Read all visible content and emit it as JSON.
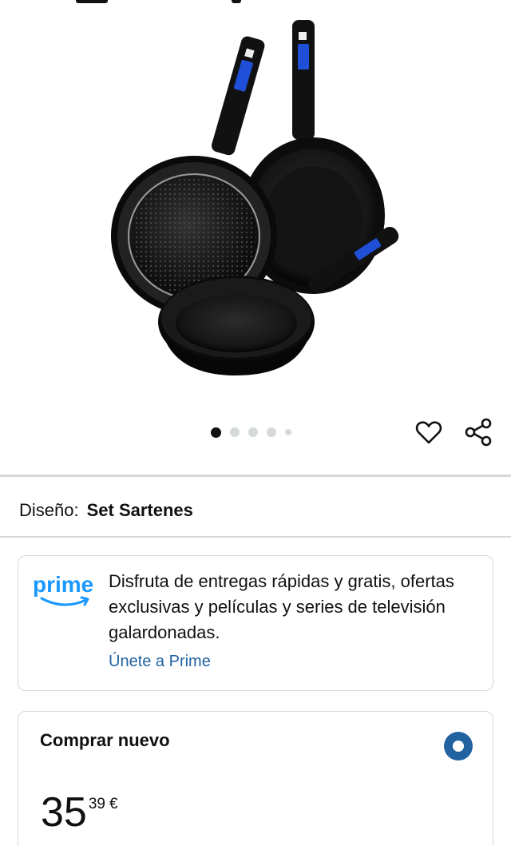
{
  "product": {
    "image_icon": "frying-pan-set-image",
    "carousel": {
      "total": 5,
      "active_index": 0
    }
  },
  "actions": {
    "wishlist_icon": "heart-icon",
    "share_icon": "share-icon"
  },
  "design": {
    "label": "Diseño:",
    "value": "Set Sartenes"
  },
  "prime": {
    "logo_text": "prime",
    "text": "Disfruta de entregas rápidas y gratis, ofertas exclusivas y películas y series de televisión galardonadas.",
    "link": "Únete a Prime",
    "brand_color": "#1a98ff"
  },
  "buy_new": {
    "title": "Comprar nuevo",
    "price_whole": "35",
    "price_fraction": "39",
    "currency": "€",
    "accent_color": "#2162a1"
  }
}
